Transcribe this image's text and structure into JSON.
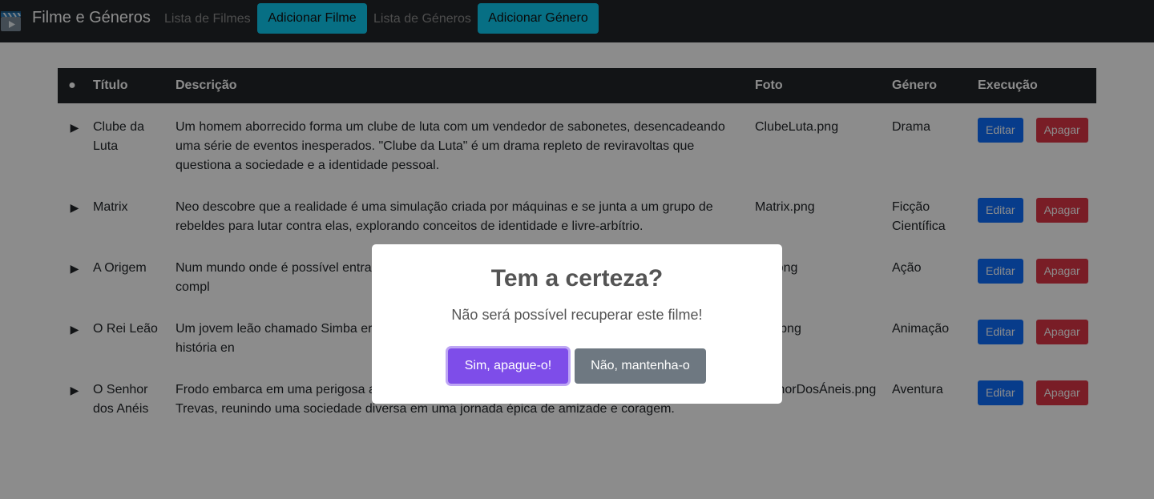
{
  "navbar": {
    "brand": "Filme e Géneros",
    "links": [
      {
        "label": "Lista de Filmes"
      },
      {
        "label": "Adicionar Filme"
      },
      {
        "label": "Lista de Géneros"
      },
      {
        "label": "Adicionar Género"
      }
    ]
  },
  "table": {
    "headers": [
      "●",
      "Título",
      "Descrição",
      "Foto",
      "Género",
      "Execução"
    ],
    "rows": [
      {
        "title": "Clube da Luta",
        "description": "Um homem aborrecido forma um clube de luta com um vendedor de sabonetes, desencadeando uma série de eventos inesperados. \"Clube da Luta\" é um drama repleto de reviravoltas que questiona a sociedade e a identidade pessoal.",
        "photo": "ClubeLuta.png",
        "genre": "Drama"
      },
      {
        "title": "Matrix",
        "description": "Neo descobre que a realidade é uma simulação criada por máquinas e se junta a um grupo de rebeldes para lutar contra elas, explorando conceitos de identidade e livre-arbítrio.",
        "photo": "Matrix.png",
        "genre": "Ficção Científica"
      },
      {
        "title": "A Origem",
        "description": "Num mundo onde é possível entra contratado para implantar uma idei ficção científica numa trama compl",
        "photo": "em.png",
        "genre": "Ação"
      },
      {
        "title": "O Rei Leão",
        "description": "Um jovem leão chamado Simba er lugar como rei após a morte do seu longo do caminho. Uma história en",
        "photo": "eão.png",
        "genre": "Animação"
      },
      {
        "title": "O Senhor dos Anéis",
        "description": "Frodo embarca em uma perigosa aventura para destruir um anel poderoso e impedir o Senhor das Trevas, reunindo uma sociedade diversa em uma jornada épica de amizade e coragem.",
        "photo": "SenhorDosÁneis.png",
        "genre": "Aventura"
      }
    ],
    "edit_label": "Editar",
    "delete_label": "Apagar",
    "row_arrow": "▶"
  },
  "modal": {
    "title": "Tem a certeza?",
    "text": "Não será possível recuperar este filme!",
    "confirm_label": "Sim, apague-o!",
    "cancel_label": "Não, mantenha-o"
  },
  "colors": {
    "navbar": "#212529",
    "info_button": "#0dcaf0",
    "edit_button": "#0d6efd",
    "delete_button": "#dc3545",
    "confirm_button": "#7e4de9",
    "cancel_button": "#6e7881"
  },
  "icons": {
    "brand": "film-clapperboard-icon",
    "row_toggle": "play-triangle-icon"
  }
}
